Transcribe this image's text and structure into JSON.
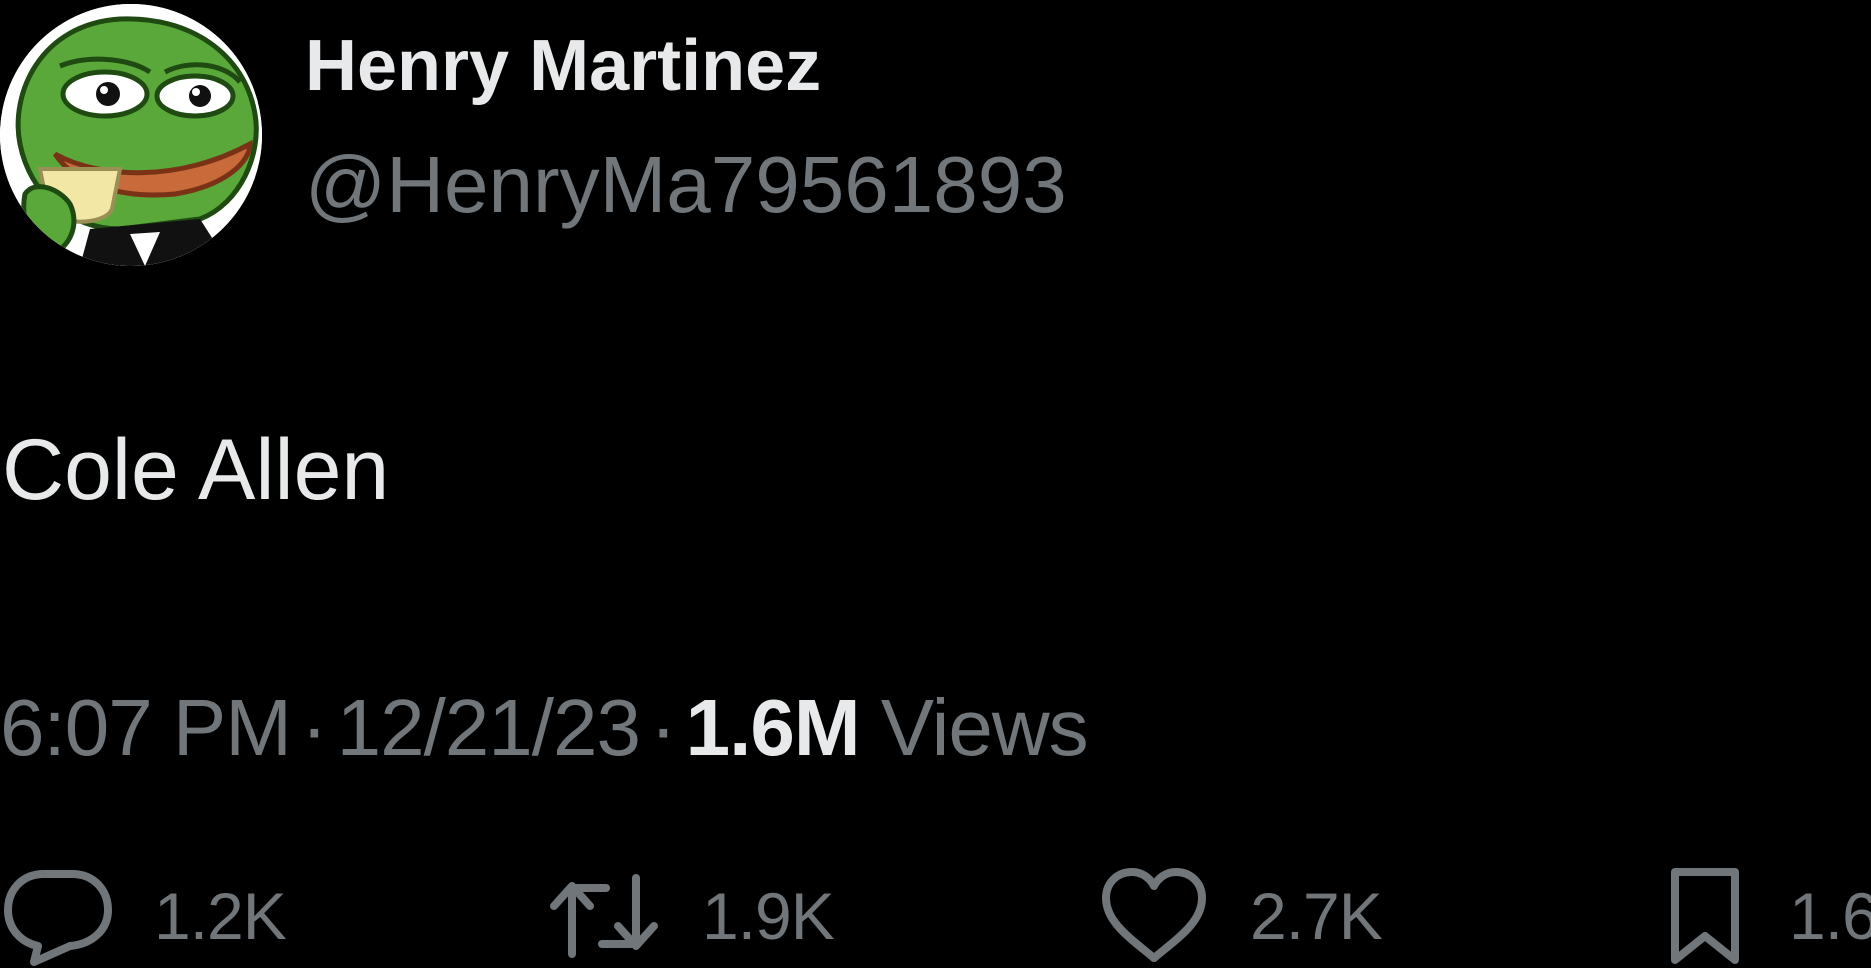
{
  "user": {
    "display_name": "Henry Martinez",
    "handle": "@HenryMa79561893",
    "avatar_icon": "pepe-frog-avatar"
  },
  "tweet": {
    "text": "Cole Allen",
    "time": "6:07 PM",
    "separator": "·",
    "date": "12/21/23",
    "views_count": "1.6M",
    "views_label": "Views"
  },
  "actions": {
    "reply": {
      "icon": "reply-icon",
      "count": "1.2K"
    },
    "retweet": {
      "icon": "retweet-icon",
      "count": "1.9K"
    },
    "like": {
      "icon": "heart-icon",
      "count": "2.7K"
    },
    "bookmark": {
      "icon": "bookmark-icon",
      "count": "1.6"
    }
  },
  "colors": {
    "background": "#000000",
    "primary_text": "#e7e9ea",
    "secondary_text": "#71767b"
  }
}
